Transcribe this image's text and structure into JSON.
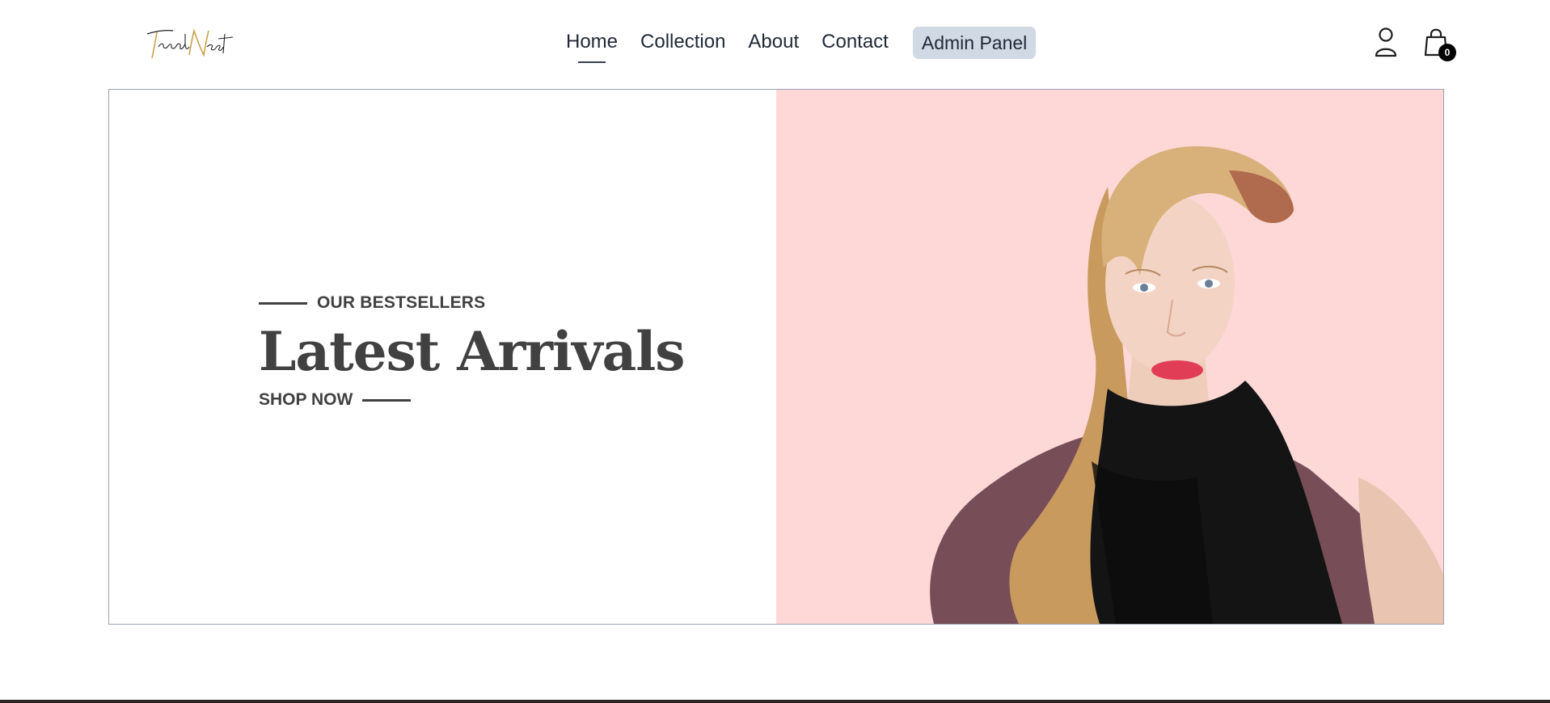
{
  "brand": {
    "logo_text_1": "Trend",
    "logo_text_2": "Nest"
  },
  "nav": {
    "links": [
      {
        "label": "Home",
        "active": true
      },
      {
        "label": "Collection",
        "active": false
      },
      {
        "label": "About",
        "active": false
      },
      {
        "label": "Contact",
        "active": false
      }
    ],
    "admin_label": "Admin Panel"
  },
  "header_icons": {
    "profile_icon": "user-icon",
    "cart_icon": "shopping-bag-icon",
    "cart_count": "0"
  },
  "hero": {
    "eyebrow": "OUR BESTSELLERS",
    "headline": "Latest Arrivals",
    "cta": "SHOP NOW",
    "image_alt": "Model with blonde hair wearing a black scarf",
    "image_bg": "#fdd8d7"
  },
  "colors": {
    "accent": "#d1d9e4",
    "text": "#414141",
    "badge": "#000000"
  }
}
